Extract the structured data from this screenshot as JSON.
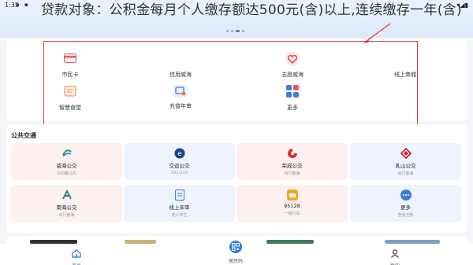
{
  "status_bar": {
    "time": "1:35",
    "icons_left": "▪ ▪",
    "icons_right": "▾◢▮"
  },
  "banner": {
    "text": "贷款对象：公积金每月个人缴存额达500元(含)以上,连续缴存一年(含)",
    "page_dots": 4,
    "active_dot": 3
  },
  "services": [
    {
      "label": "市民卡",
      "icon": "card-icon",
      "color": "#e85a5a"
    },
    {
      "label": "信用威海",
      "icon": "",
      "color": ""
    },
    {
      "label": "志愿威海",
      "icon": "heart-icon",
      "color": "#e8524a"
    },
    {
      "label": "线上商城",
      "icon": "",
      "color": ""
    },
    {
      "label": "智慧食堂",
      "icon": "canteen-icon",
      "color": "#f07b3a"
    },
    {
      "label": "充值年审",
      "icon": "recharge-icon",
      "color": "#3a7de0"
    },
    {
      "label": "更多",
      "icon": "more-grid-icon",
      "color": "#3a7de0"
    }
  ],
  "transit": {
    "title": "公共交通",
    "items": [
      {
        "name": "威海公交",
        "sub": "200路以内",
        "icon": "weihai-bus-logo",
        "color": "#2b9a5a",
        "bg": "pink"
      },
      {
        "name": "交运公交",
        "sub": "201-213",
        "icon": "jiaoyun-logo",
        "color": "#1e3f8a",
        "bg": "blue"
      },
      {
        "name": "荣成公交",
        "sub": "出行客海",
        "icon": "rongcheng-logo",
        "color": "#d9332f",
        "bg": "pink"
      },
      {
        "name": "乳山公交",
        "sub": "出行客海",
        "icon": "rushan-logo",
        "color": "#c0262a",
        "bg": "blue"
      },
      {
        "name": "南海公交",
        "sub": "出行客海",
        "icon": "nanhai-logo",
        "color": "#1e9a6e",
        "bg": "pink"
      },
      {
        "name": "线上年审",
        "sub": "老人学生",
        "icon": "annual-review-icon",
        "color": "#3a7de0",
        "bg": "blue"
      },
      {
        "name": "95128",
        "sub": "一键打车",
        "icon": "taxi-icon",
        "color": "#f5a623",
        "bg": "pink"
      },
      {
        "name": "更多",
        "sub": "查看全部",
        "icon": "more-chat-icon",
        "color": "#3a7de0",
        "bg": "blue"
      }
    ]
  },
  "nav": {
    "home": "首页",
    "center": "居民码",
    "me": "我的"
  },
  "colors": {
    "accent": "#2f7de1",
    "highlight_box": "#e03a3a"
  }
}
